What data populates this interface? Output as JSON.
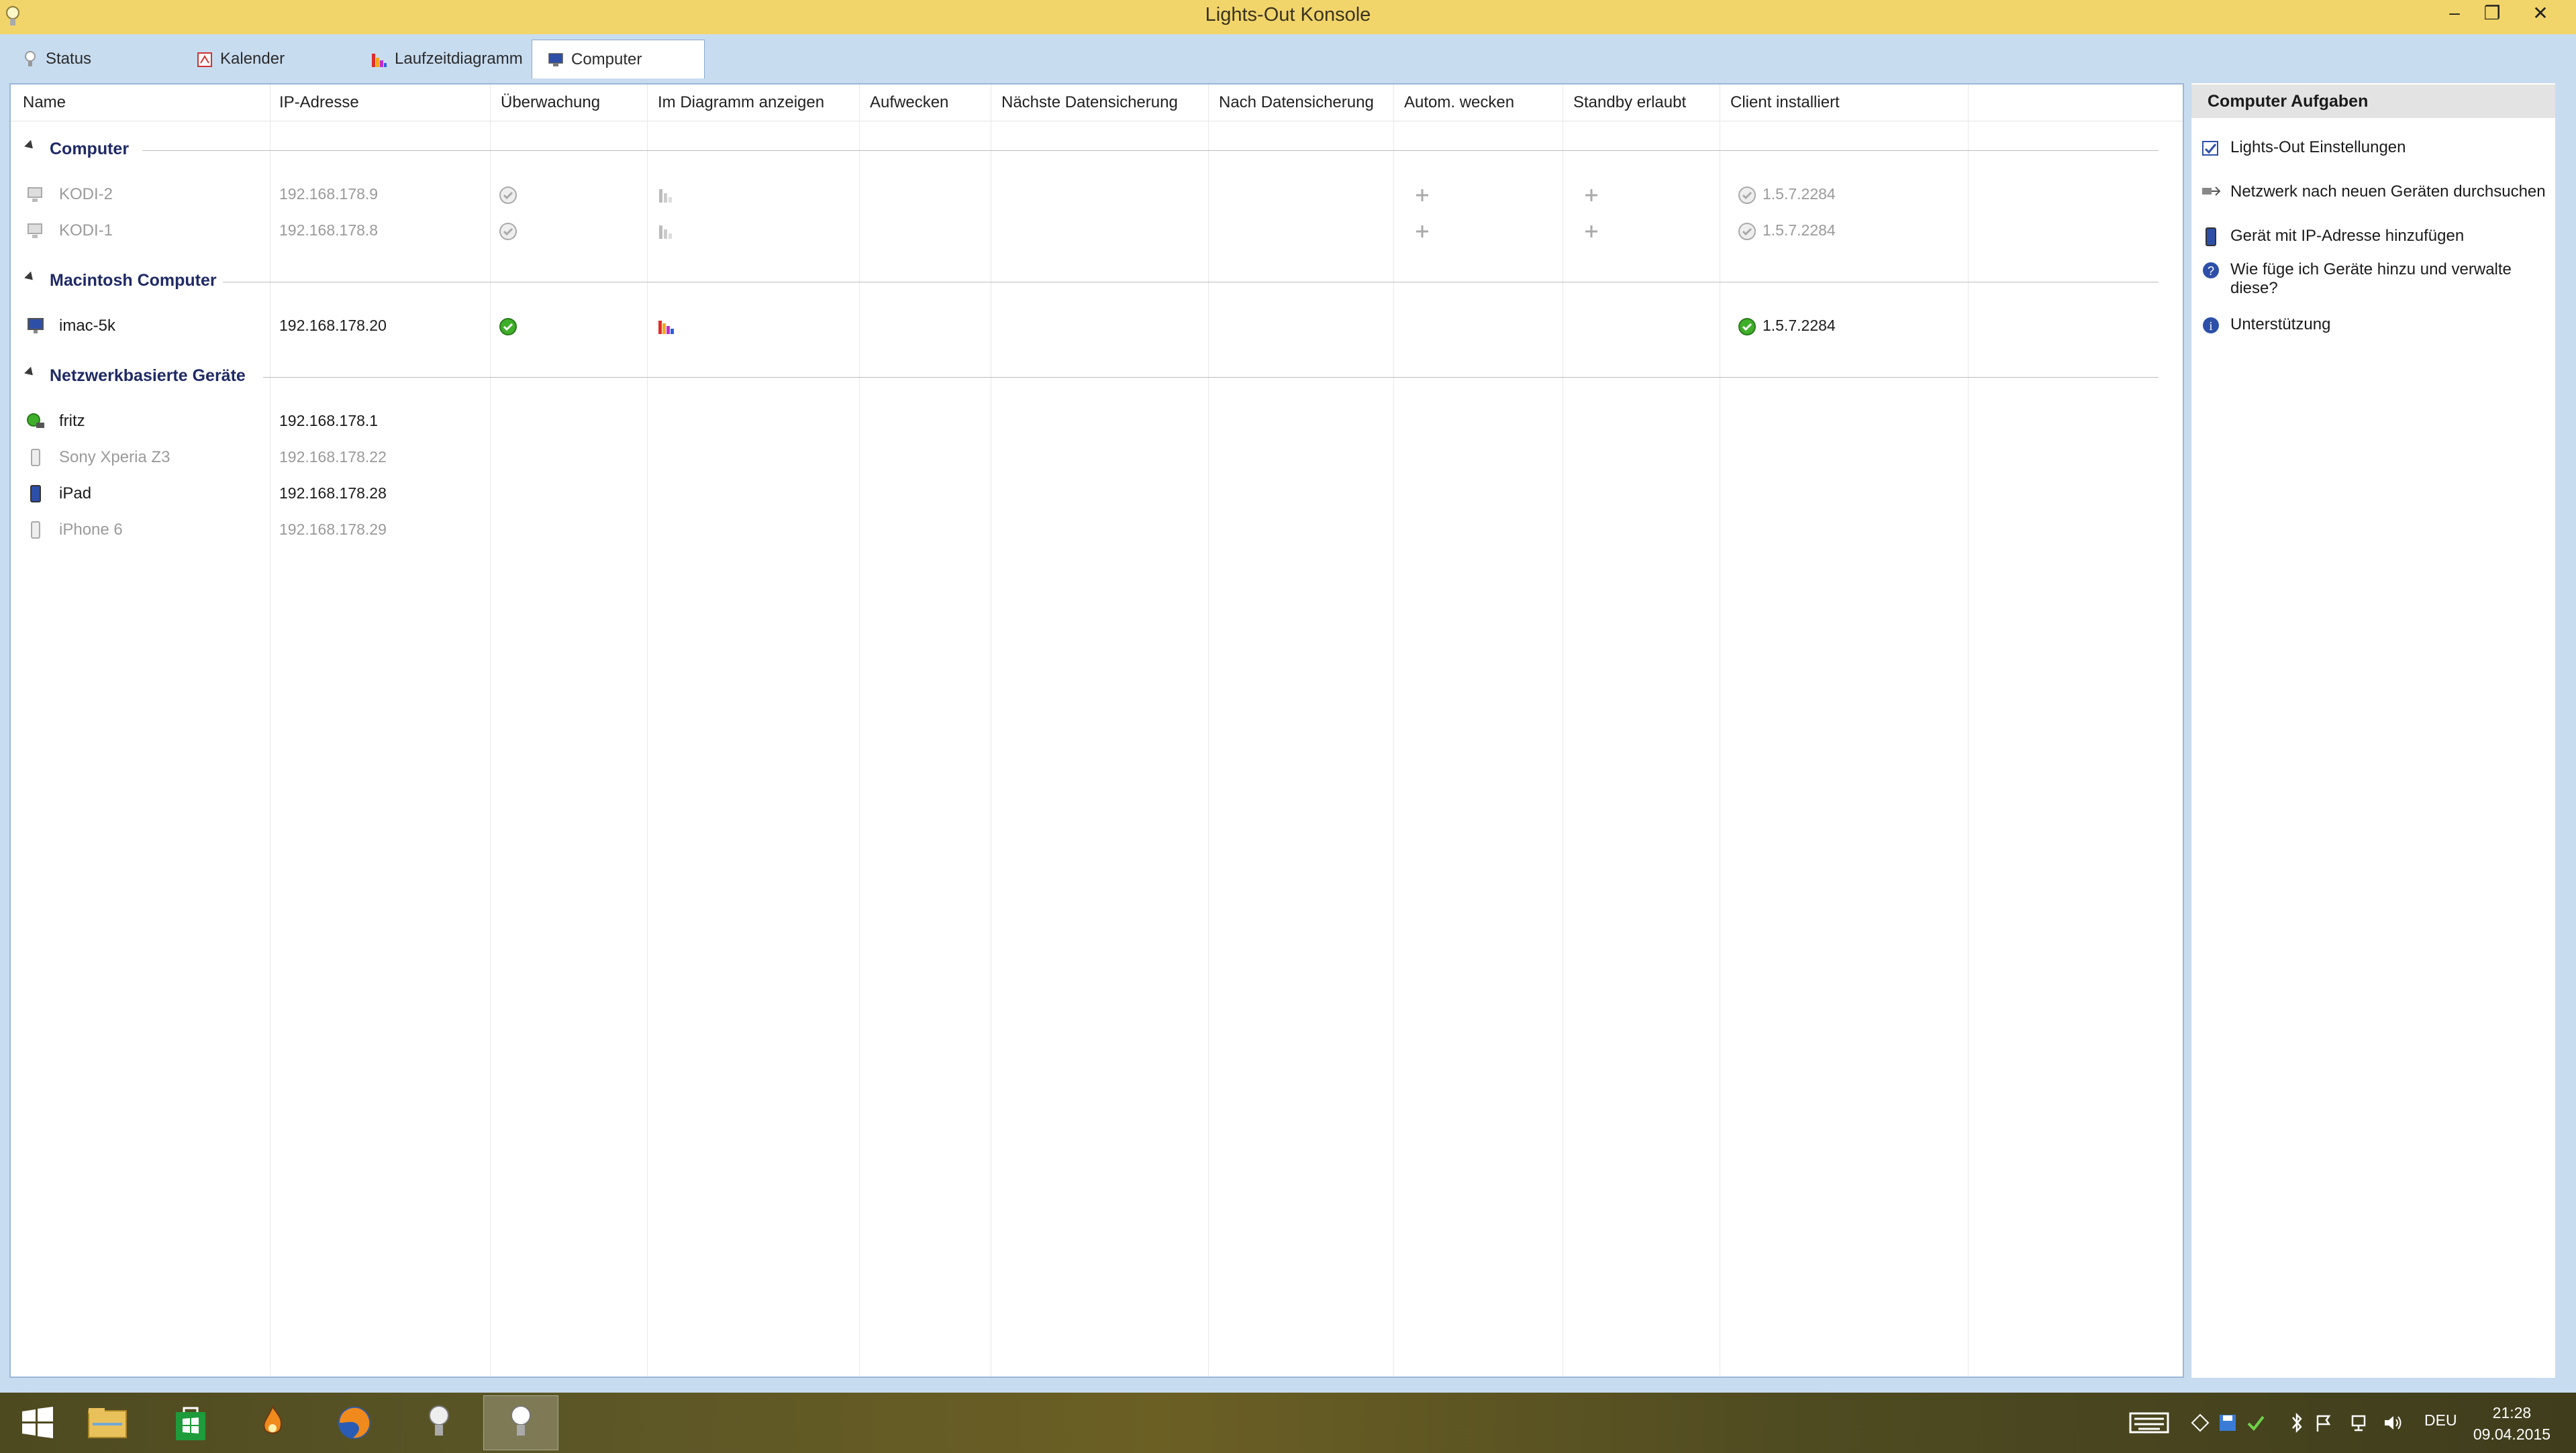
{
  "window": {
    "title": "Lights-Out Konsole",
    "minimize_glyph": "–",
    "restore_glyph": "❐",
    "close_glyph": "✕"
  },
  "tabs": [
    {
      "label": "Status",
      "icon": "bulb-icon"
    },
    {
      "label": "Kalender",
      "icon": "calendar-icon"
    },
    {
      "label": "Laufzeitdiagramm",
      "icon": "bar-chart-icon"
    },
    {
      "label": "Computer",
      "icon": "computer-icon",
      "active": true
    }
  ],
  "table": {
    "columns": [
      "Name",
      "IP-Adresse",
      "Überwachung",
      "Im Diagramm anzeigen",
      "Aufwecken",
      "Nächste Datensicherung",
      "Nach Datensicherung",
      "Autom. wecken",
      "Standby erlaubt",
      "Client installiert"
    ],
    "groups": [
      {
        "label": "Computer",
        "rows": [
          {
            "name": "KODI-2",
            "ip": "192.168.178.9",
            "active": false,
            "version": "1.5.7.2284"
          },
          {
            "name": "KODI-1",
            "ip": "192.168.178.8",
            "active": false,
            "version": "1.5.7.2284"
          }
        ]
      },
      {
        "label": "Macintosh Computer",
        "rows": [
          {
            "name": "imac-5k",
            "ip": "192.168.178.20",
            "active": true,
            "version": "1.5.7.2284"
          }
        ]
      },
      {
        "label": "Netzwerkbasierte Geräte",
        "rows": [
          {
            "name": "fritz",
            "ip": "192.168.178.1",
            "active": true
          },
          {
            "name": "Sony Xperia Z3",
            "ip": "192.168.178.22",
            "active": false
          },
          {
            "name": "iPad",
            "ip": "192.168.178.28",
            "active": true
          },
          {
            "name": "iPhone 6",
            "ip": "192.168.178.29",
            "active": false
          }
        ]
      }
    ]
  },
  "tasks": {
    "title": "Computer Aufgaben",
    "items": [
      {
        "label": "Lights-Out Einstellungen",
        "icon": "settings-checkbox-icon"
      },
      {
        "label": "Netzwerk nach neuen Geräten durchsuchen",
        "icon": "network-scan-icon"
      },
      {
        "label": "Gerät mit IP-Adresse hinzufügen",
        "icon": "add-device-icon"
      },
      {
        "label": "Wie füge ich Geräte hinzu und verwalte diese?",
        "icon": "help-icon"
      },
      {
        "label": "Unterstützung",
        "icon": "info-icon"
      }
    ]
  },
  "taskbar": {
    "language": "DEU",
    "time": "21:28",
    "date": "09.04.2015"
  },
  "colors": {
    "titlebar": "#f2d56a",
    "chrome": "#c8dcf0",
    "group_label": "#1f2a66",
    "ok_green": "#3fae2a"
  }
}
